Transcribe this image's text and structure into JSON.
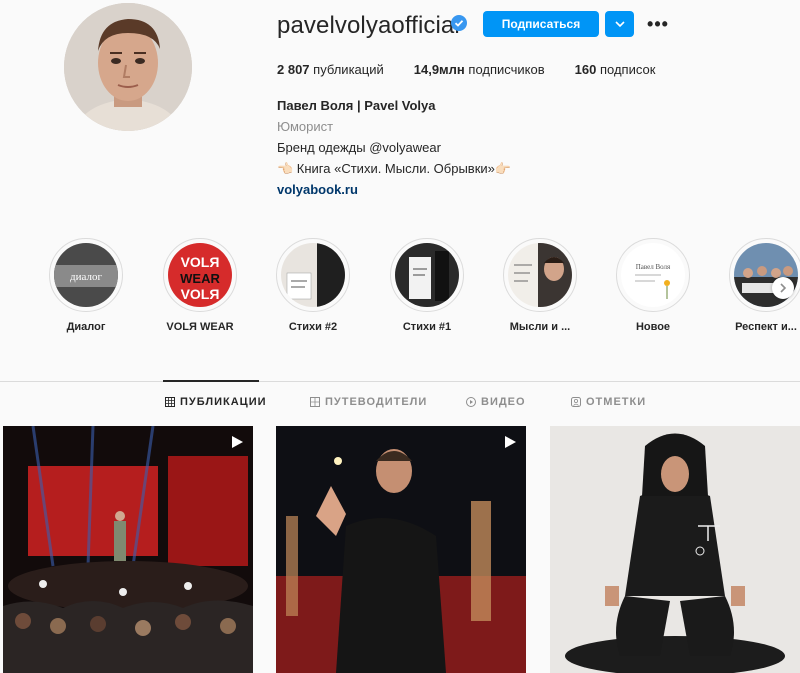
{
  "profile": {
    "username": "pavelvolyaofficial",
    "follow_label": "Подписаться",
    "more_label": "•••"
  },
  "stats": [
    {
      "count": "2 807",
      "label": "публикаций"
    },
    {
      "count": "14,9млн",
      "label": "подписчиков"
    },
    {
      "count": "160",
      "label": "подписок"
    }
  ],
  "bio": {
    "name": "Павел Воля | Pavel Volya",
    "category": "Юморист",
    "line1": "Бренд одежды @volyawear",
    "line2": "👈🏻 Книга «Стихи. Мысли. Обрывки»👉🏻",
    "link": "volyabook.ru"
  },
  "highlights": [
    {
      "label": "Диалог"
    },
    {
      "label": "VOLЯ WEAR"
    },
    {
      "label": "Стихи #2"
    },
    {
      "label": "Стихи #1"
    },
    {
      "label": "Мысли и ..."
    },
    {
      "label": "Новое"
    },
    {
      "label": "Респект и..."
    }
  ],
  "highlight_art": {
    "dialog_text": "диалог",
    "volya_text": "VOLЯ",
    "wear_text": "WEAR",
    "book_text": "Павел Воля"
  },
  "tabs": [
    {
      "label": "ПУБЛИКАЦИИ",
      "icon": "grid-icon"
    },
    {
      "label": "ПУТЕВОДИТЕЛИ",
      "icon": "guide-icon"
    },
    {
      "label": "ВИДЕО",
      "icon": "video-icon"
    },
    {
      "label": "ОТМЕТКИ",
      "icon": "tagged-icon"
    }
  ],
  "colors": {
    "accent": "#0095f6",
    "text": "#262626",
    "muted": "#8e8e8e",
    "link": "#00376b",
    "background": "#fafafa"
  }
}
